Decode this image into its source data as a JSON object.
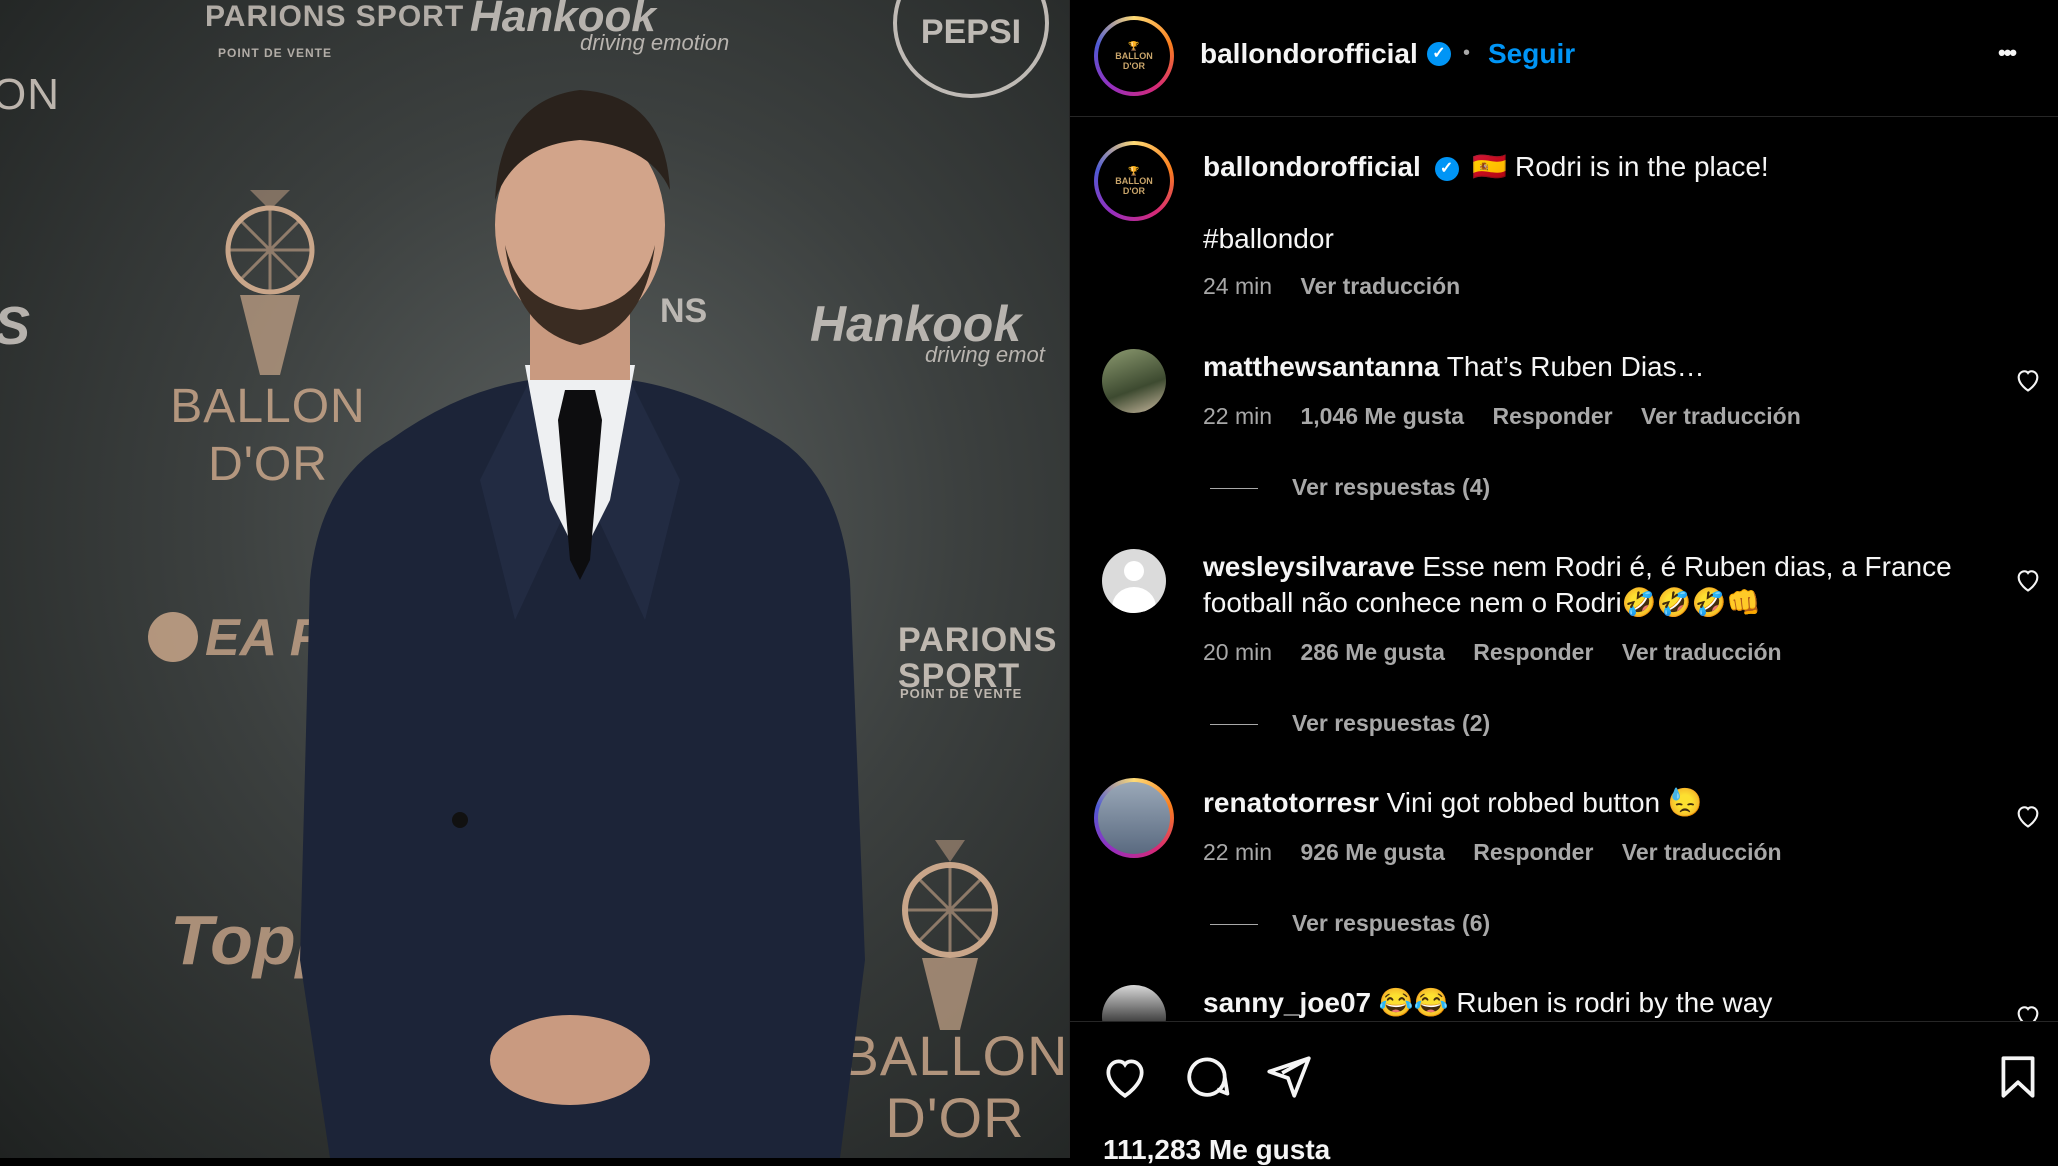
{
  "photo": {
    "wall_labels": {
      "parions_top": "PARIONS SPORT",
      "point_de_vente": "POINT DE VENTE",
      "hankook_top": "Hankook",
      "driving_emotion": "driving emotion",
      "pepsi": "PEPSI",
      "ballon_dor_left": "BALLON D'OR",
      "hankook_right": "Hankook",
      "driving_emotion_right": "driving emot",
      "ea_fc": "EA FC2",
      "parions_right": "PARIONS SPORT",
      "point_de_vente_right": "POINT DE VENTE",
      "topps": "Topps",
      "ballon_dor_right": "BALLON D'OR",
      "on_left": "ON",
      "ns_mid": "NS",
      "s_left": "S"
    }
  },
  "header": {
    "username": "ballondorofficial",
    "separator": "•",
    "follow_label": "Seguir",
    "more_label": "•••"
  },
  "caption": {
    "username": "ballondorofficial",
    "flag": "🇪🇸",
    "text": "Rodri is in the place!",
    "hashtag": "#ballondor",
    "time": "24 min",
    "translate": "Ver traducción"
  },
  "comments": [
    {
      "username": "matthewsantanna",
      "text": "That’s Ruben Dias…",
      "time": "22 min",
      "likes": "1,046 Me gusta",
      "reply": "Responder",
      "translate": "Ver traducción",
      "replies": "Ver respuestas (4)"
    },
    {
      "username": "wesleysilvarave",
      "text": "Esse nem Rodri é, é Ruben dias, a France football não conhece nem o Rodri🤣🤣🤣👊",
      "time": "20 min",
      "likes": "286 Me gusta",
      "reply": "Responder",
      "translate": "Ver traducción",
      "replies": "Ver respuestas (2)"
    },
    {
      "username": "renatotorresr",
      "text": "Vini got robbed button 😓",
      "time": "22 min",
      "likes": "926 Me gusta",
      "reply": "Responder",
      "translate": "Ver traducción",
      "replies": "Ver respuestas (6)"
    },
    {
      "username": "sanny_joe07",
      "text": "😂😂 Ruben is rodri by the way"
    }
  ],
  "footer": {
    "likes_count": "111,283 Me gusta"
  },
  "icons": {
    "like": "heart-icon",
    "comment": "comment-icon",
    "share": "send-icon",
    "save": "bookmark-icon"
  },
  "colors": {
    "accent": "#0095f6",
    "background": "#000000",
    "muted": "#a8a8a8"
  }
}
